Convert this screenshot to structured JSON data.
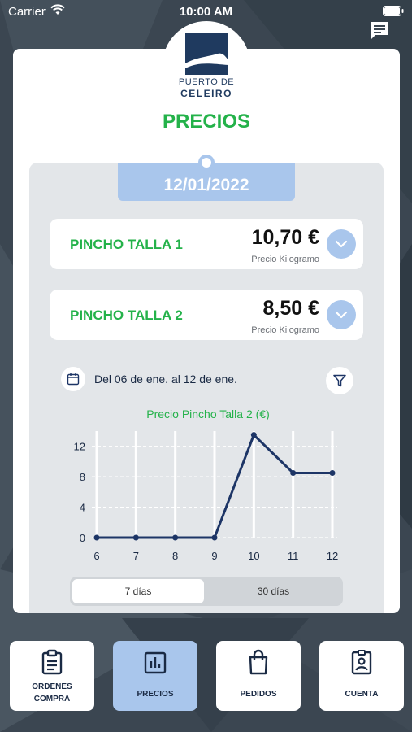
{
  "status_bar": {
    "carrier": "Carrier",
    "time": "10:00 AM",
    "wifi_icon": "wifi-icon",
    "battery_icon": "battery-icon"
  },
  "header": {
    "chat_icon": "chat-icon",
    "logo": {
      "line1": "PUERTO DE",
      "line2": "CELEIRO"
    }
  },
  "page": {
    "title": "PRECIOS",
    "date": "12/01/2022"
  },
  "prices": [
    {
      "name": "PINCHO TALLA 1",
      "value": "10,70 €",
      "unit": "Precio Kilogramo"
    },
    {
      "name": "PINCHO TALLA 2",
      "value": "8,50 €",
      "unit": "Precio Kilogramo"
    }
  ],
  "filter": {
    "range_text": "Del 06 de ene. al 12 de ene."
  },
  "chart_data": {
    "type": "line",
    "title": "Precio Pincho Talla 2 (€)",
    "xlabel": "",
    "ylabel": "",
    "x": [
      6,
      7,
      8,
      9,
      10,
      11,
      12
    ],
    "series": [
      {
        "values": [
          0,
          0,
          0,
          0,
          13.5,
          8.5,
          8.5
        ]
      }
    ],
    "xlim": [
      6,
      12
    ],
    "ylim": [
      0,
      14
    ],
    "yticks": [
      0,
      4,
      8,
      12
    ],
    "grid": "horizontal dashed, vertical solid",
    "colors": {
      "line": "#1d3566",
      "grid": "#ffffff"
    }
  },
  "segment": {
    "options": [
      "7 días",
      "30 días"
    ],
    "selected": "7 días"
  },
  "tabs": [
    {
      "label_line1": "ORDENES",
      "label_line2": "COMPRA",
      "icon": "clipboard-list-icon",
      "active": false
    },
    {
      "label_line1": "PRECIOS",
      "label_line2": "",
      "icon": "bar-chart-icon",
      "active": true
    },
    {
      "label_line1": "PEDIDOS",
      "label_line2": "",
      "icon": "shopping-bag-icon",
      "active": false
    },
    {
      "label_line1": "CUENTA",
      "label_line2": "",
      "icon": "account-badge-icon",
      "active": false
    }
  ],
  "colors": {
    "accent_green": "#24b24a",
    "accent_blue": "#a9c6ec",
    "navy": "#1d3566",
    "background": "#3b4651"
  }
}
